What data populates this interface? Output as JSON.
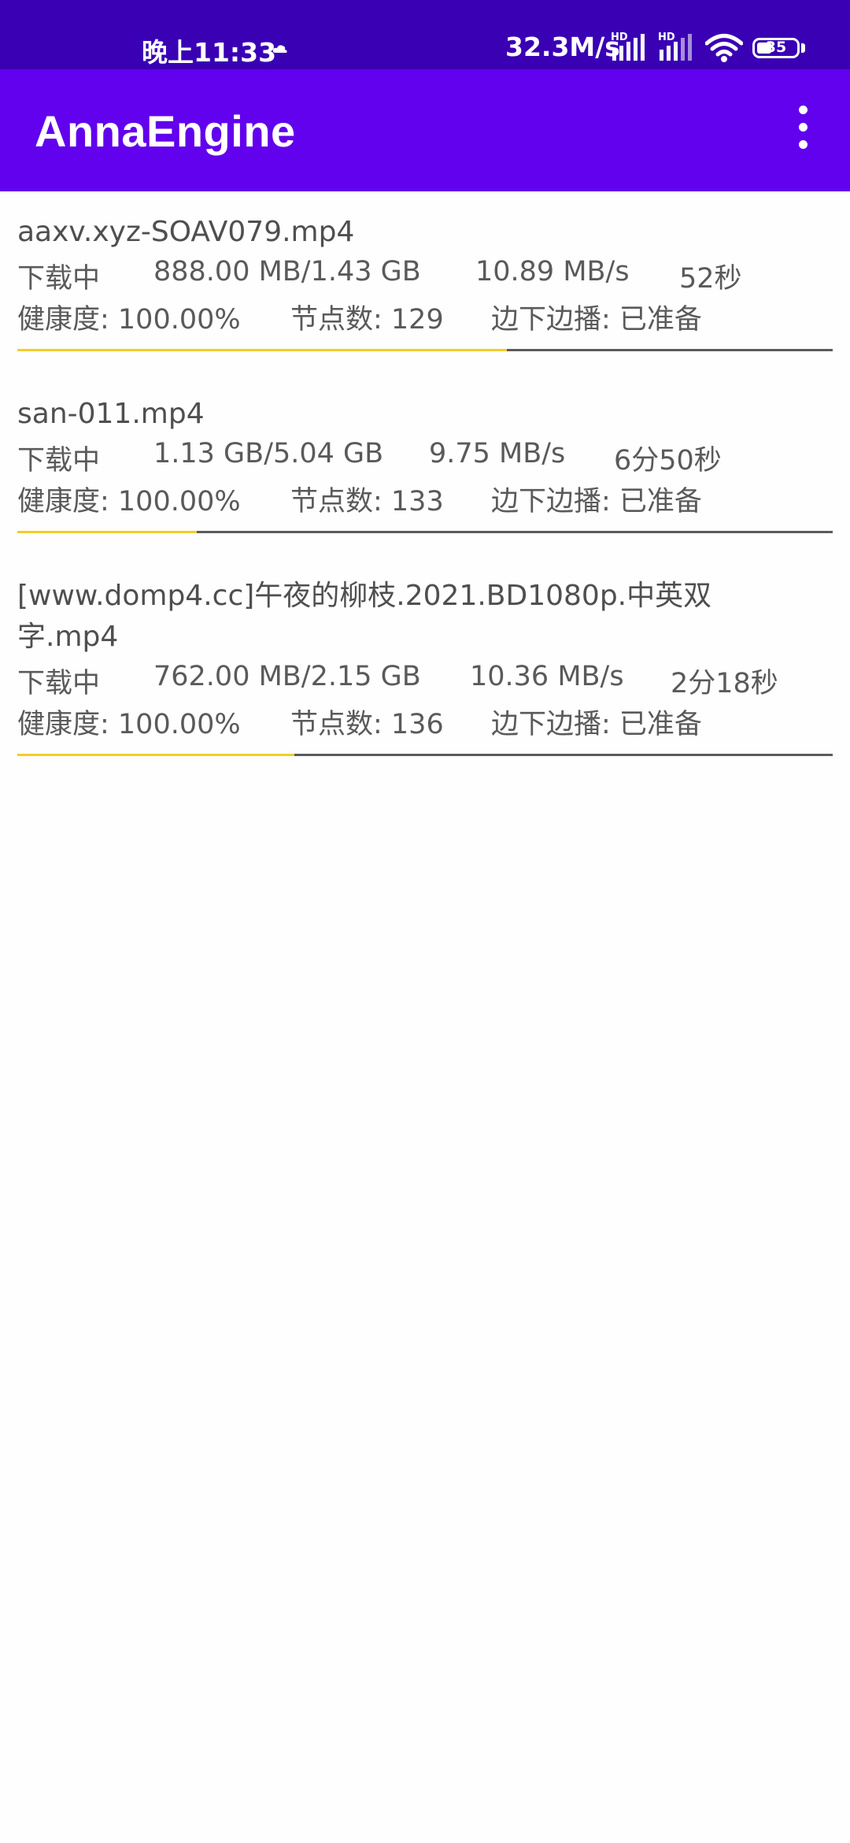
{
  "status_bar": {
    "time": "晚上11:33",
    "net_speed": "32.3M/s",
    "hd_label": "HD",
    "battery": "35",
    "icons": [
      "cloud-icon",
      "signal-icon",
      "signal-icon",
      "wifi-icon",
      "battery-icon"
    ]
  },
  "app_bar": {
    "title": "AnnaEngine",
    "menu_icon": "more-vert-icon"
  },
  "colors": {
    "status_bar": "#3a00b4",
    "app_bar": "#6201ed",
    "progress_fill": "#f2cd29",
    "progress_track": "#5b5b5b"
  },
  "downloads": [
    {
      "name": "aaxv.xyz-SOAV079.mp4",
      "status": "下载中",
      "size": "888.00 MB/1.43 GB",
      "speed": "10.89 MB/s",
      "eta": "52秒",
      "health": "健康度: 100.00%",
      "peers": "节点数: 129",
      "stream": "边下边播: 已准备",
      "progress": 0.6
    },
    {
      "name": "san-011.mp4",
      "status": "下载中",
      "size": "1.13 GB/5.04 GB",
      "speed": "9.75 MB/s",
      "eta": "6分50秒",
      "health": "健康度: 100.00%",
      "peers": "节点数: 133",
      "stream": "边下边播: 已准备",
      "progress": 0.22
    },
    {
      "name": "[www.domp4.cc]午夜的柳枝.2021.BD1080p.中英双字.mp4",
      "status": "下载中",
      "size": "762.00 MB/2.15 GB",
      "speed": "10.36 MB/s",
      "eta": "2分18秒",
      "health": "健康度: 100.00%",
      "peers": "节点数: 136",
      "stream": "边下边播: 已准备",
      "progress": 0.34
    }
  ]
}
